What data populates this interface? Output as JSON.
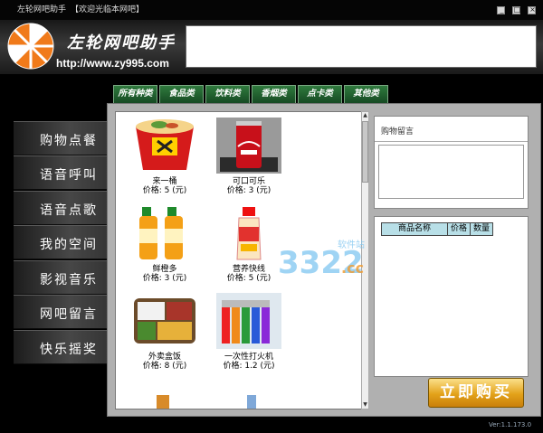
{
  "window": {
    "app_title": "左轮网吧助手",
    "welcome": "【欢迎光临本网吧】",
    "controls": [
      "minimize-icon",
      "maximize-icon",
      "close-icon"
    ]
  },
  "header": {
    "brand": "左轮网吧助手",
    "url": "http://www.zy995.com"
  },
  "nav": {
    "items": [
      {
        "label": "购物点餐"
      },
      {
        "label": "语音呼叫"
      },
      {
        "label": "语音点歌"
      },
      {
        "label": "我的空间"
      },
      {
        "label": "影视音乐"
      },
      {
        "label": "网吧留言"
      },
      {
        "label": "快乐摇奖"
      }
    ]
  },
  "tabs": [
    {
      "label": "所有种类"
    },
    {
      "label": "食品类"
    },
    {
      "label": "饮料类"
    },
    {
      "label": "香烟类"
    },
    {
      "label": "点卡类"
    },
    {
      "label": "其他类"
    }
  ],
  "products": [
    {
      "name": "来一桶",
      "price": "价格: 5 (元)"
    },
    {
      "name": "可口可乐",
      "price": "价格: 3 (元)"
    },
    {
      "name": "鲜橙多",
      "price": "价格: 3 (元)"
    },
    {
      "name": "营养快线",
      "price": "价格: 5 (元)"
    },
    {
      "name": "外卖盒饭",
      "price": "价格: 8 (元)"
    },
    {
      "name": "一次性打火机",
      "price": "价格: 1.2 (元)"
    }
  ],
  "message": {
    "label": "购物留言",
    "value": ""
  },
  "cart": {
    "columns": [
      "商品名称",
      "价格",
      "数量"
    ]
  },
  "buy_button": "立即购买",
  "version": "Ver:1.1.173.0",
  "watermark": {
    "brand": "3322",
    "domain": ".cc",
    "label": "软件站"
  },
  "colors": {
    "tab_green": "#2f7a3d",
    "buy_orange": "#e3a21a",
    "cart_header": "#b8dfe7"
  }
}
